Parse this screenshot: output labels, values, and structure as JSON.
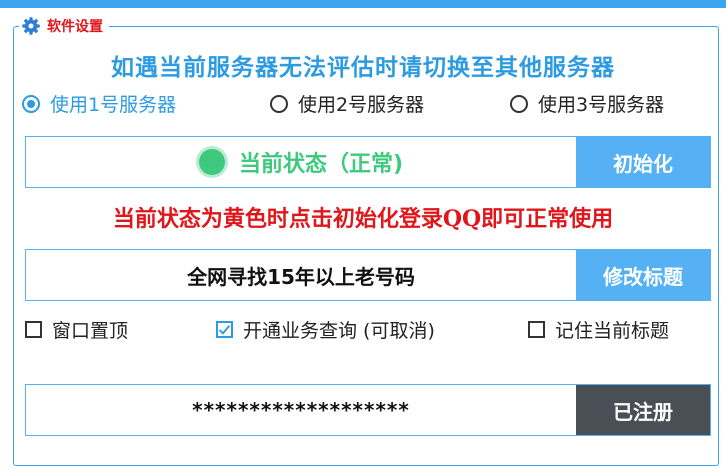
{
  "groupbox": {
    "title": "软件设置",
    "icon": "gear-icon"
  },
  "notice_top": "如遇当前服务器无法评估时请切换至其他服务器",
  "servers": [
    {
      "label": "使用1号服务器",
      "checked": true
    },
    {
      "label": "使用2号服务器",
      "checked": false
    },
    {
      "label": "使用3号服务器",
      "checked": false
    }
  ],
  "status": {
    "text": "当前状态（正常)",
    "color": "#3ec97e",
    "button": "初始化"
  },
  "notice_bottom": "当前状态为黄色时点击初始化登录QQ即可正常使用",
  "title_row": {
    "value": "全网寻找15年以上老号码",
    "button": "修改标题"
  },
  "options": [
    {
      "label": "窗口置顶",
      "checked": false
    },
    {
      "label": "开通业务查询 (可取消)",
      "checked": true
    },
    {
      "label": "记住当前标题",
      "checked": false
    }
  ],
  "register_row": {
    "value": "*******************",
    "button": "已注册"
  },
  "colors": {
    "accent": "#3da5f0",
    "warning": "#e0161b",
    "ok": "#3ec97e",
    "dark_button": "#4a4f55"
  }
}
